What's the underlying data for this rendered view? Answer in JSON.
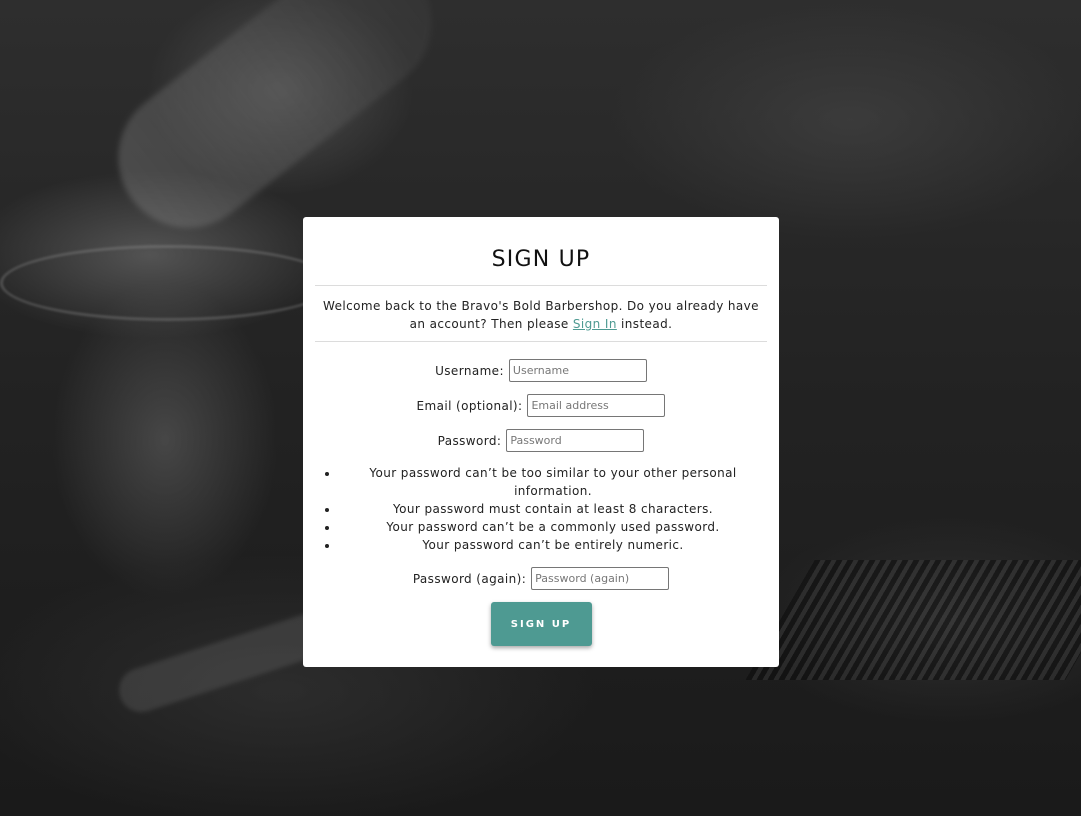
{
  "page": {
    "title": "SIGN UP",
    "welcome_text": "Welcome back to the Bravo's Bold Barbershop. Do you already have an account? Then please ",
    "signin_link": "Sign In",
    "welcome_suffix": " instead."
  },
  "form": {
    "username": {
      "label": "Username:",
      "placeholder": "Username"
    },
    "email": {
      "label": "Email (optional):",
      "placeholder": "Email address"
    },
    "password": {
      "label": "Password:",
      "placeholder": "Password"
    },
    "help": [
      "Your password can’t be too similar to your other personal information.",
      "Your password must contain at least 8 characters.",
      "Your password can’t be a commonly used password.",
      "Your password can’t be entirely numeric."
    ],
    "password2": {
      "label": "Password (again):",
      "placeholder": "Password (again)"
    },
    "submit": "SIGN UP"
  },
  "colors": {
    "accent": "#4e9a92",
    "card": "#ffffff",
    "backdrop": "#1e1e1e"
  }
}
